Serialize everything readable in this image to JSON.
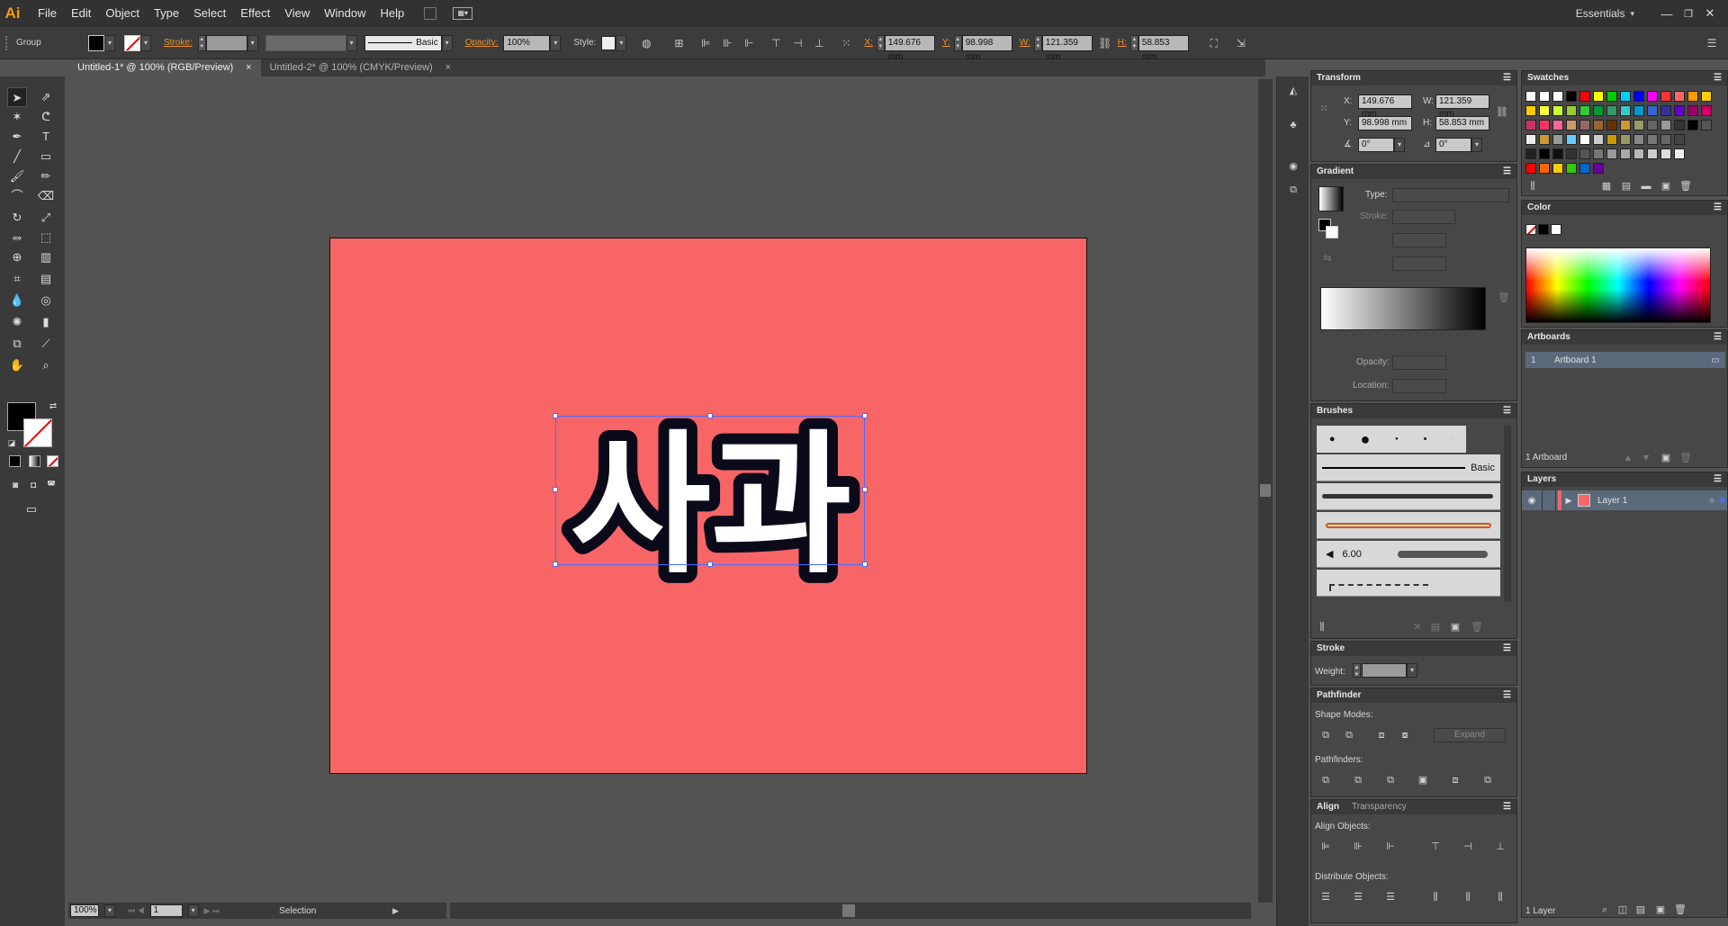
{
  "app": {
    "logo": "Ai",
    "workspace": "Essentials"
  },
  "menu": [
    "File",
    "Edit",
    "Object",
    "Type",
    "Select",
    "Effect",
    "View",
    "Window",
    "Help"
  ],
  "control": {
    "selection_type": "Group",
    "stroke_label": "Stroke:",
    "brush_name": "Basic",
    "opacity_label": "Opacity:",
    "opacity_value": "100%",
    "style_label": "Style:",
    "x_label": "X:",
    "x_value": "149.676 mm",
    "y_label": "Y:",
    "y_value": "98.998 mm",
    "w_label": "W:",
    "w_value": "121.359 mm",
    "h_label": "H:",
    "h_value": "58.853 mm"
  },
  "tabs": [
    {
      "label": "Untitled-1* @ 100% (RGB/Preview)",
      "close": "×"
    },
    {
      "label": "Untitled-2* @ 100% (CMYK/Preview)",
      "close": "×"
    }
  ],
  "artwork": {
    "text": "사과",
    "artboard_color": "#f86567"
  },
  "status": {
    "zoom": "100%",
    "page": "1",
    "tool": "Selection"
  },
  "transform": {
    "title": "Transform",
    "x_label": "X:",
    "x_value": "149.676 mm",
    "y_label": "Y:",
    "y_value": "98.998 mm",
    "w_label": "W:",
    "w_value": "121.359 mm",
    "h_label": "H:",
    "h_value": "58.853 mm",
    "angle_value": "0°",
    "shear_value": "0°"
  },
  "gradient": {
    "title": "Gradient",
    "type_label": "Type:",
    "stroke_label": "Stroke:",
    "opacity_label": "Opacity:",
    "location_label": "Location:"
  },
  "brushes": {
    "title": "Brushes",
    "basic_label": "Basic",
    "size_value": "6.00"
  },
  "stroke": {
    "title": "Stroke",
    "weight_label": "Weight:"
  },
  "pathfinder": {
    "title": "Pathfinder",
    "shape_modes_label": "Shape Modes:",
    "expand_label": "Expand",
    "pathfinders_label": "Pathfinders:"
  },
  "align": {
    "title": "Align",
    "transparency_tab": "Transparency",
    "align_objects_label": "Align Objects:",
    "distribute_objects_label": "Distribute Objects:"
  },
  "swatches": {
    "title": "Swatches"
  },
  "color": {
    "title": "Color"
  },
  "artboards": {
    "title": "Artboards",
    "items": [
      {
        "num": "1",
        "name": "Artboard 1"
      }
    ],
    "count_label": "1 Artboard"
  },
  "layers": {
    "title": "Layers",
    "items": [
      {
        "name": "Layer 1"
      }
    ],
    "count_label": "1 Layer"
  }
}
